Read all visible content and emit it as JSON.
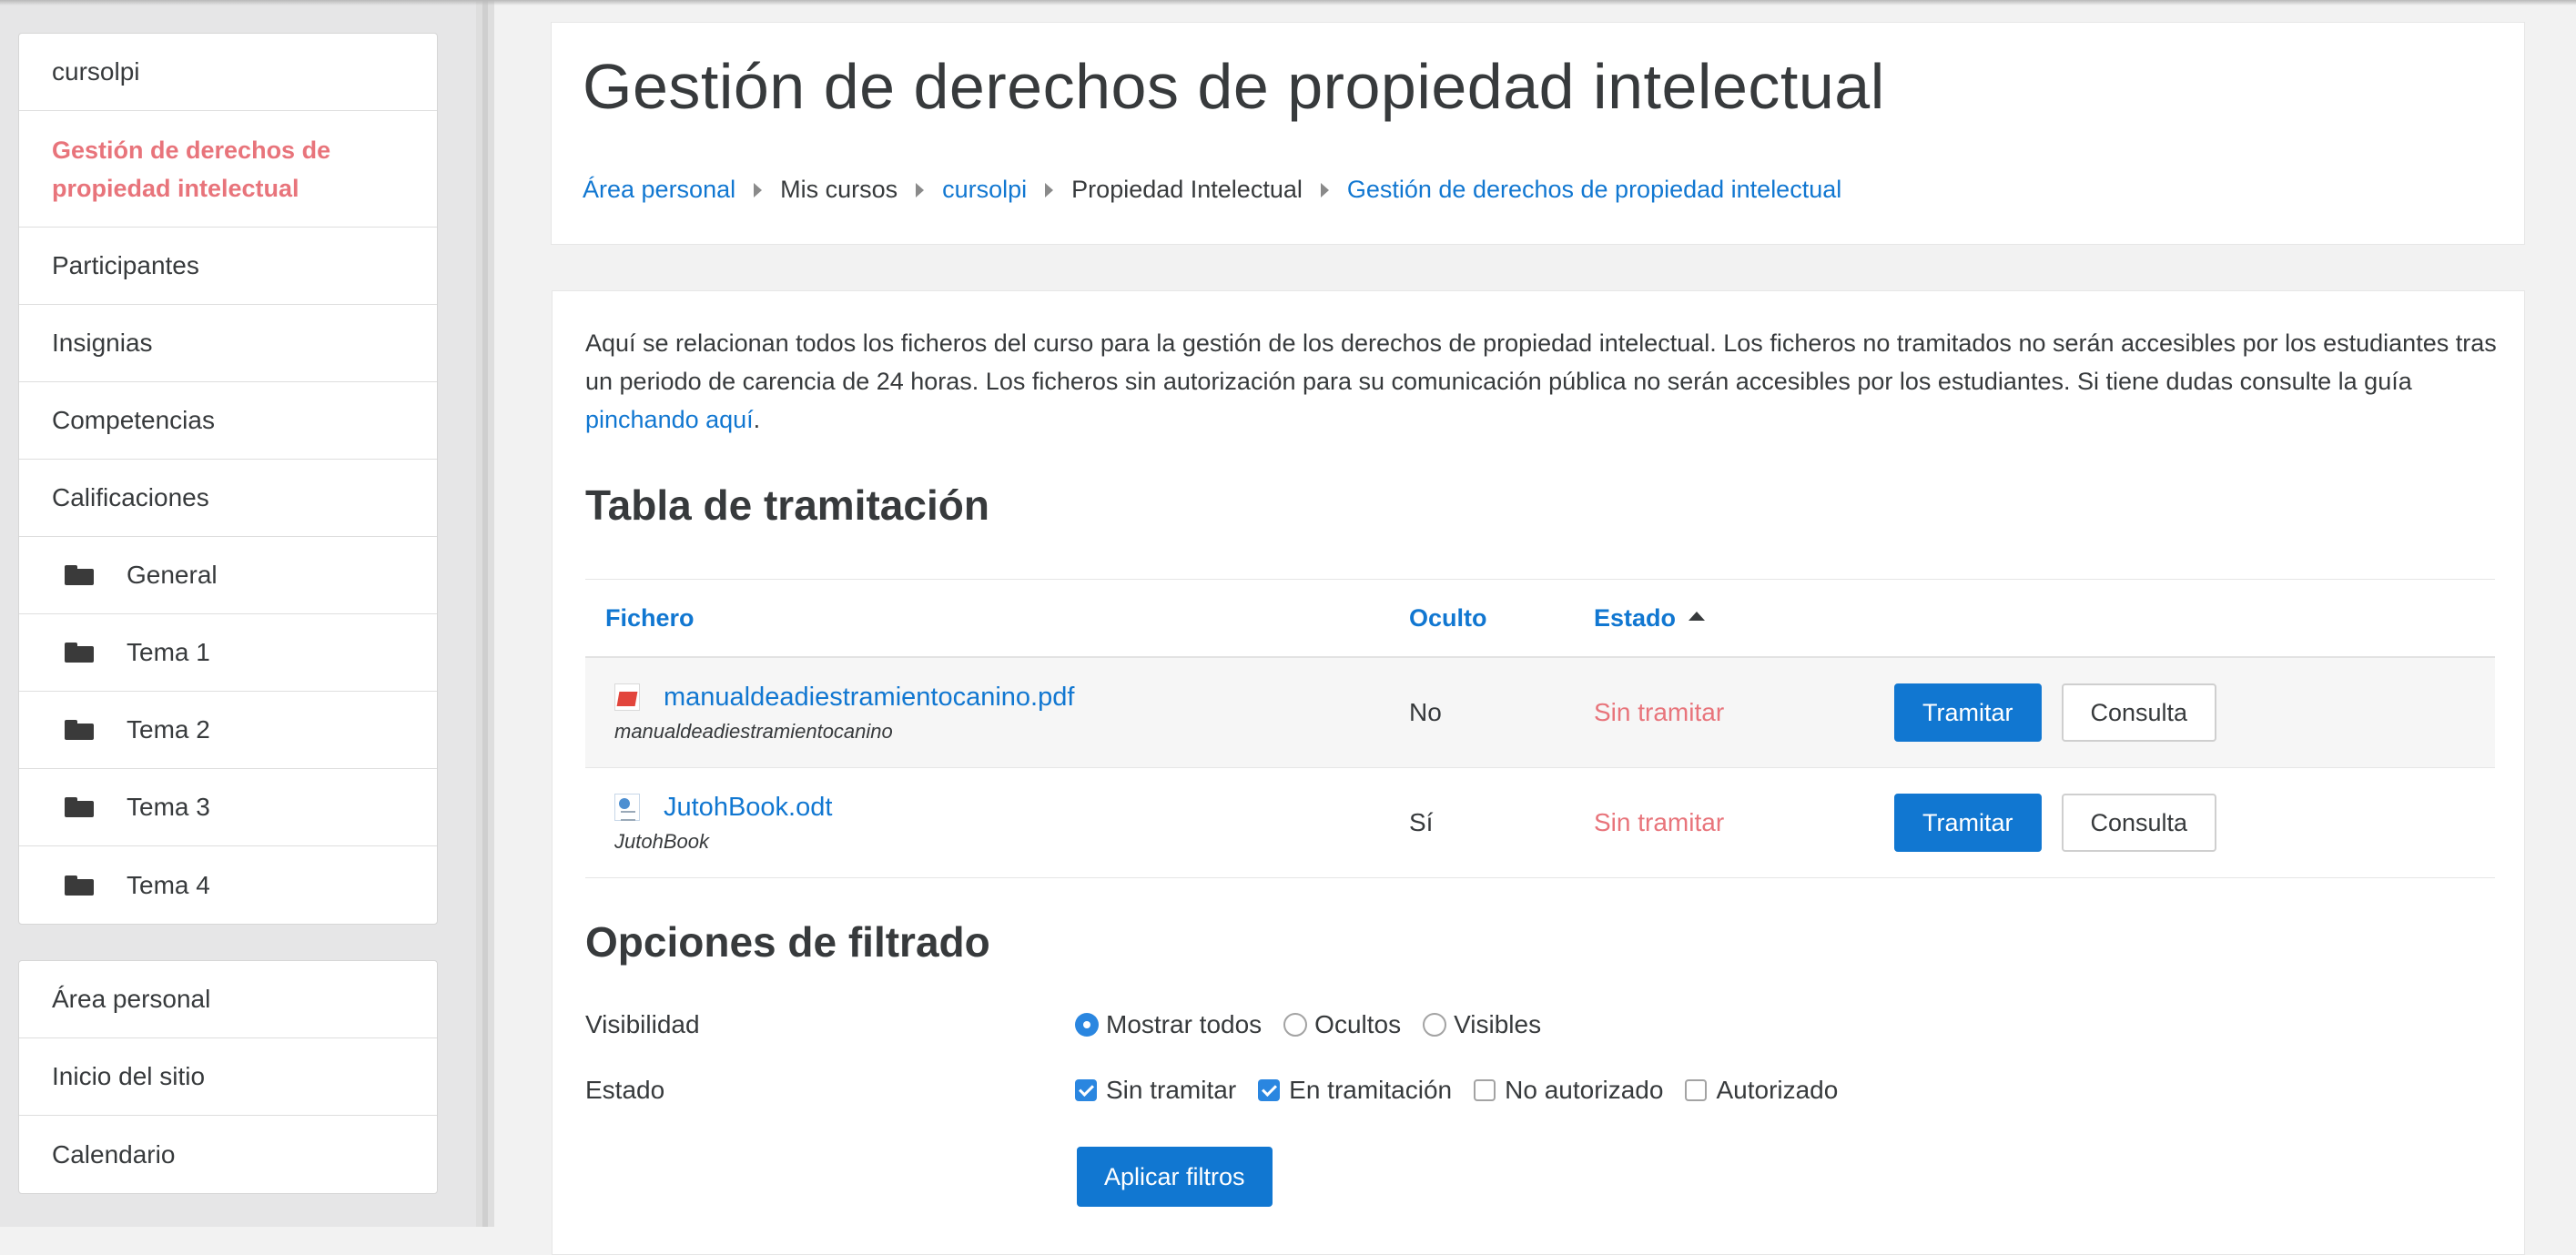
{
  "sidebar": {
    "course_block": [
      {
        "label": "cursolpi",
        "active": false,
        "icon": ""
      },
      {
        "label": "Gestión de derechos de propiedad intelectual",
        "active": true,
        "icon": ""
      },
      {
        "label": "Participantes",
        "active": false,
        "icon": ""
      },
      {
        "label": "Insignias",
        "active": false,
        "icon": ""
      },
      {
        "label": "Competencias",
        "active": false,
        "icon": ""
      },
      {
        "label": "Calificaciones",
        "active": false,
        "icon": ""
      },
      {
        "label": "General",
        "active": false,
        "icon": "folder-icon"
      },
      {
        "label": "Tema 1",
        "active": false,
        "icon": "folder-icon"
      },
      {
        "label": "Tema 2",
        "active": false,
        "icon": "folder-icon"
      },
      {
        "label": "Tema 3",
        "active": false,
        "icon": "folder-icon"
      },
      {
        "label": "Tema 4",
        "active": false,
        "icon": "folder-icon"
      }
    ],
    "site_block": [
      {
        "label": "Área personal"
      },
      {
        "label": "Inicio del sitio"
      },
      {
        "label": "Calendario"
      }
    ]
  },
  "header": {
    "title": "Gestión de derechos de propiedad intelectual",
    "breadcrumb": [
      {
        "label": "Área personal",
        "link": true
      },
      {
        "label": "Mis cursos",
        "link": false
      },
      {
        "label": "cursolpi",
        "link": true
      },
      {
        "label": "Propiedad Intelectual",
        "link": false
      },
      {
        "label": "Gestión de derechos de propiedad intelectual",
        "link": true
      }
    ]
  },
  "main": {
    "intro_text": "Aquí se relacionan todos los ficheros del curso para la gestión de los derechos de propiedad intelectual. Los ficheros no tramitados no serán accesibles por los estudiantes tras un periodo de carencia de 24 horas. Los ficheros sin autorización para su comunicación pública no serán accesibles por los estudiantes. Si tiene dudas consulte la guía ",
    "intro_link": "pinchando aquí",
    "intro_end": ".",
    "table_title": "Tabla de tramitación",
    "table": {
      "headers": {
        "file": "Fichero",
        "hidden": "Oculto",
        "state": "Estado"
      },
      "sorted_by": "Estado",
      "sort_direction": "ascending",
      "rows": [
        {
          "file_name": "manualdeadiestramientocanino.pdf",
          "file_sub": "manualdeadiestramientocanino",
          "file_icon": "pdf-icon",
          "hidden": "No",
          "state": "Sin tramitar",
          "action_primary": "Tramitar",
          "action_secondary": "Consulta"
        },
        {
          "file_name": "JutohBook.odt",
          "file_sub": "JutohBook",
          "file_icon": "odt-icon",
          "hidden": "Sí",
          "state": "Sin tramitar",
          "action_primary": "Tramitar",
          "action_secondary": "Consulta"
        }
      ]
    },
    "filter_title": "Opciones de filtrado",
    "filters": {
      "visibility_label": "Visibilidad",
      "visibility_options": [
        {
          "label": "Mostrar todos",
          "checked": true
        },
        {
          "label": "Ocultos",
          "checked": false
        },
        {
          "label": "Visibles",
          "checked": false
        }
      ],
      "state_label": "Estado",
      "state_options": [
        {
          "label": "Sin tramitar",
          "checked": true
        },
        {
          "label": "En tramitación",
          "checked": true
        },
        {
          "label": "No autorizado",
          "checked": false
        },
        {
          "label": "Autorizado",
          "checked": false
        }
      ],
      "apply_label": "Aplicar filtros"
    }
  },
  "colors": {
    "link": "#1177d1",
    "active_nav": "#e8747b",
    "status_pending": "#e8747b",
    "primary_button": "#1177d1",
    "checkbox_checked": "#2a86e0"
  }
}
